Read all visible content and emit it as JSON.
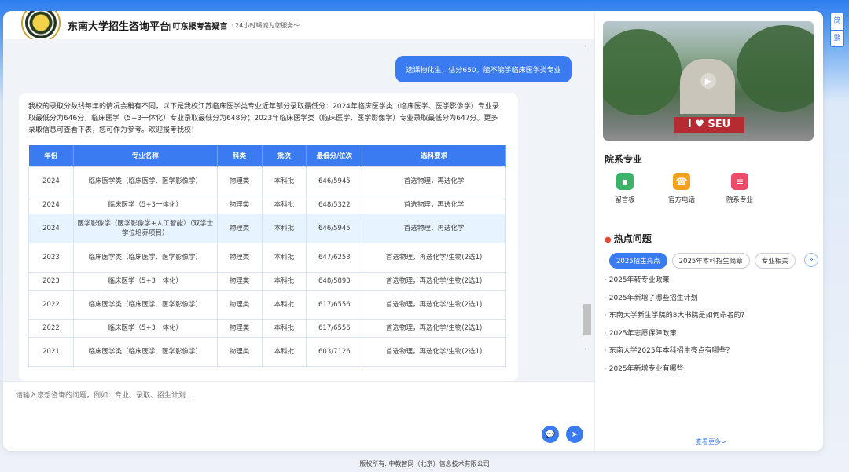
{
  "header": {
    "logo_text": "東南大學",
    "title": "东南大学招生咨询平台",
    "subtitle": "叮东报考答疑官",
    "tagline": "· 24小时竭诚为您服务～"
  },
  "chat": {
    "user_message": "选课物化生，估分650，能不能学临床医学类专业",
    "bot_text": "我校的录取分数线每年的情况会稍有不同，以下是我校江苏临床医学类专业近年部分录取最低分：2024年临床医学类（临床医学、医学影像学）专业录取最低分为646分，临床医学（5+3一体化）专业录取最低分为648分；2023年临床医学类（临床医学、医学影像学）专业录取最低分为647分。更多录取信息可查看下表，您可作为参考。欢迎报考我校！",
    "table": {
      "headers": [
        "年份",
        "专业名称",
        "科类",
        "批次",
        "最低分/位次",
        "选科要求"
      ],
      "rows": [
        [
          "2024",
          "临床医学类（临床医学、医学影像学）",
          "物理类",
          "本科批",
          "646/5945",
          "首选物理，再选化学"
        ],
        [
          "2024",
          "临床医学（5+3一体化）",
          "物理类",
          "本科批",
          "648/5322",
          "首选物理，再选化学"
        ],
        [
          "2024",
          "医学影像学（医学影像学+人工智能）（双学士学位培养项目）",
          "物理类",
          "本科批",
          "646/5945",
          "首选物理，再选化学"
        ],
        [
          "2023",
          "临床医学类（临床医学、医学影像学）",
          "物理类",
          "本科批",
          "647/6253",
          "首选物理，再选化学/生物(2选1)"
        ],
        [
          "2023",
          "临床医学（5+3一体化）",
          "物理类",
          "本科批",
          "648/5893",
          "首选物理，再选化学/生物(2选1)"
        ],
        [
          "2022",
          "临床医学类（临床医学、医学影像学）",
          "物理类",
          "本科批",
          "617/6556",
          "首选物理，再选化学/生物(2选1)"
        ],
        [
          "2022",
          "临床医学（5+3一体化）",
          "物理类",
          "本科批",
          "617/6556",
          "首选物理，再选化学/生物(2选1)"
        ],
        [
          "2021",
          "临床医学类（临床医学、医学影像学）",
          "物理类",
          "本科批",
          "603/7126",
          "首选物理，再选化学/生物(2选1)"
        ]
      ]
    },
    "input_placeholder": "请输入您想咨询的问题，例如：专业、录取、招生计划..."
  },
  "sidebar": {
    "video_sign": "I ♥ SEU",
    "features_title": "院系专业",
    "features": [
      {
        "label": "留言板",
        "icon": "message-icon",
        "color": "#3bb46a"
      },
      {
        "label": "官方电话",
        "icon": "phone-icon",
        "color": "#f4a21e"
      },
      {
        "label": "院系专业",
        "icon": "document-icon",
        "color": "#ee4b6a"
      }
    ],
    "hot_title": "热点问题",
    "tabs": [
      "2025招生亮点",
      "2025年本科招生简章",
      "专业相关"
    ],
    "questions": [
      "2025年转专业政策",
      "2025年新增了哪些招生计划",
      "东南大学新生学院的8大书院是如何命名的？",
      "2025年志愿保障政策",
      "东南大学2025年本科招生亮点有哪些？",
      "2025年新增专业有哪些"
    ],
    "more": "查看更多>"
  },
  "side_toggle": [
    "简",
    "繁"
  ],
  "footer": "版权所有: 中教智网（北京）信息技术有限公司",
  "colors": {
    "accent": "#3a7bf1",
    "table_highlight": "#e7f4ff"
  }
}
